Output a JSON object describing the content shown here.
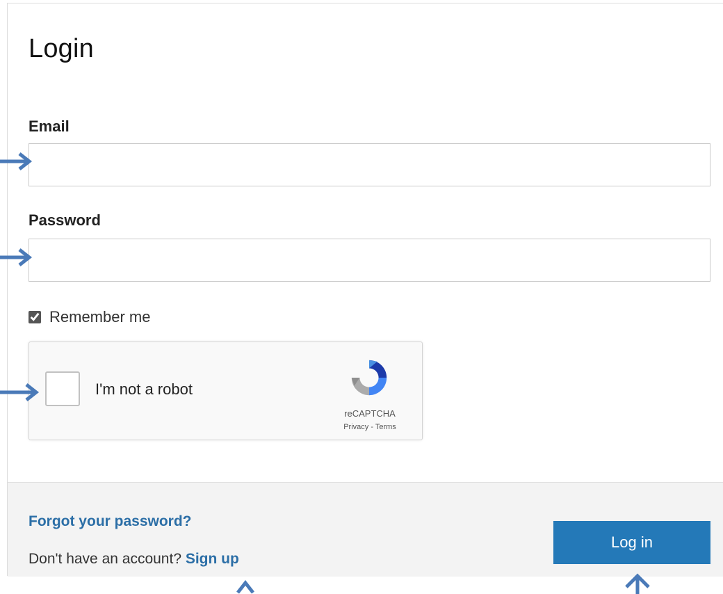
{
  "form": {
    "title": "Login",
    "email_label": "Email",
    "email_value": "",
    "password_label": "Password",
    "password_value": "",
    "remember_label": "Remember me",
    "remember_checked": true
  },
  "captcha": {
    "label": "I'm not a robot",
    "brand": "reCAPTCHA",
    "links": "Privacy - Terms"
  },
  "footer": {
    "forgot_label": "Forgot your password?",
    "no_account_text": "Don't have an account? ",
    "signup_label": "Sign up",
    "login_label": "Log in"
  },
  "colors": {
    "link": "#2b6ea6",
    "button": "#2479b8",
    "arrow": "#4a7ab8"
  }
}
